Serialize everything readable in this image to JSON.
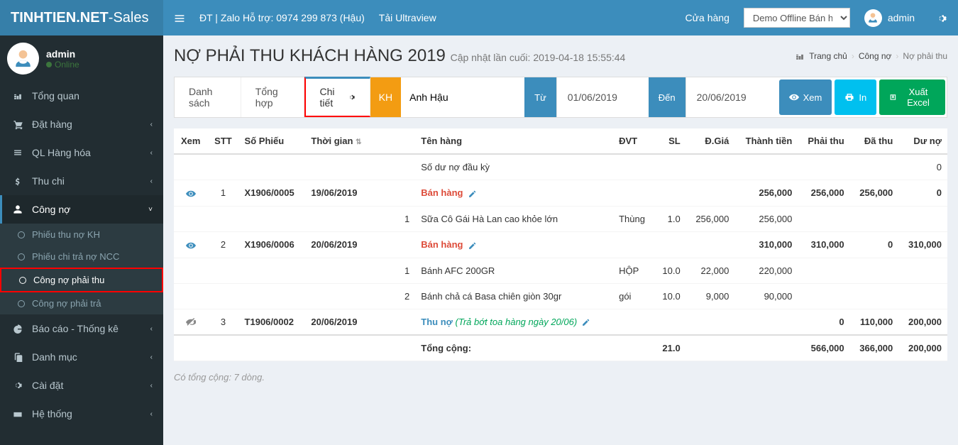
{
  "brand": {
    "b1": "TINHTIEN.NET",
    "b2": "-Sales"
  },
  "topbar": {
    "support": "ĐT | Zalo Hỗ trợ: 0974 299 873 (Hậu)",
    "ultraview": "Tải Ultraview",
    "store_label": "Cửa hàng",
    "store_value": "Demo Offline Bán hàn",
    "user": "admin"
  },
  "user_panel": {
    "name": "admin",
    "status": "Online"
  },
  "sidebar": {
    "items": [
      {
        "label": "Tổng quan",
        "icon": "dashboard",
        "expandable": false
      },
      {
        "label": "Đặt hàng",
        "icon": "cart",
        "expandable": true
      },
      {
        "label": "QL Hàng hóa",
        "icon": "list",
        "expandable": true
      },
      {
        "label": "Thu chi",
        "icon": "dollar",
        "expandable": true
      },
      {
        "label": "Công nợ",
        "icon": "user",
        "expandable": true,
        "open": true,
        "children": [
          {
            "label": "Phiếu thu nợ KH"
          },
          {
            "label": "Phiếu chi trả nợ NCC"
          },
          {
            "label": "Công nợ phải thu",
            "active": true
          },
          {
            "label": "Công nợ phải trả"
          }
        ]
      },
      {
        "label": "Báo cáo - Thống kê",
        "icon": "pie",
        "expandable": true
      },
      {
        "label": "Danh mục",
        "icon": "copy",
        "expandable": true
      },
      {
        "label": "Cài đặt",
        "icon": "gear",
        "expandable": true
      },
      {
        "label": "Hệ thống",
        "icon": "window",
        "expandable": true
      }
    ]
  },
  "page": {
    "title": "NỢ PHẢI THU KHÁCH HÀNG 2019",
    "subtitle": "Cập nhật lần cuối: 2019-04-18 15:55:44"
  },
  "breadcrumb": {
    "home": "Trang chủ",
    "b1": "Công nợ",
    "b2": "Nợ phải thu"
  },
  "tabs": {
    "list": "Danh sách",
    "summary": "Tổng hợp",
    "detail": "Chi tiết"
  },
  "filter": {
    "kh_label": "KH",
    "kh_value": "Anh Hậu",
    "from_label": "Từ",
    "from_value": "01/06/2019",
    "to_label": "Đến",
    "to_value": "20/06/2019",
    "btn_view": "Xem",
    "btn_print": "In",
    "btn_excel": "Xuất Excel"
  },
  "table": {
    "headers": {
      "view": "Xem",
      "stt": "STT",
      "phieu": "Số Phiếu",
      "time": "Thời gian",
      "name": "Tên hàng",
      "dvt": "ĐVT",
      "sl": "SL",
      "dgia": "Đ.Giá",
      "thanhtien": "Thành tiền",
      "phaithu": "Phải thu",
      "dathu": "Đã thu",
      "duno": "Dư nợ"
    },
    "opening_row": {
      "name": "Số dư nợ đầu kỳ",
      "duno": "0"
    },
    "rows": [
      {
        "type": "header",
        "eye": "on",
        "stt": "1",
        "phieu": "X1906/0005",
        "time": "19/06/2019",
        "name": "Bán hàng",
        "name_class": "red",
        "thanhtien": "256,000",
        "phaithu": "256,000",
        "dathu": "256,000",
        "duno": "0"
      },
      {
        "type": "item",
        "stt_item": "1",
        "name": "Sữa Cô Gái Hà Lan cao khỏe lớn",
        "dvt": "Thùng",
        "sl": "1.0",
        "dgia": "256,000",
        "thanhtien": "256,000"
      },
      {
        "type": "header",
        "eye": "on",
        "stt": "2",
        "phieu": "X1906/0006",
        "time": "20/06/2019",
        "name": "Bán hàng",
        "name_class": "red",
        "thanhtien": "310,000",
        "phaithu": "310,000",
        "dathu": "0",
        "duno": "310,000"
      },
      {
        "type": "item",
        "stt_item": "1",
        "name": "Bánh AFC 200GR",
        "dvt": "HỘP",
        "sl": "10.0",
        "dgia": "22,000",
        "thanhtien": "220,000"
      },
      {
        "type": "item",
        "stt_item": "2",
        "name": "Bánh chả cá Basa chiên giòn 30gr",
        "dvt": "gói",
        "sl": "10.0",
        "dgia": "9,000",
        "thanhtien": "90,000"
      },
      {
        "type": "header",
        "eye": "off",
        "stt": "3",
        "phieu": "T1906/0002",
        "time": "20/06/2019",
        "name": "Thu nợ",
        "name_class": "blue",
        "note": "(Trả bớt toa hàng ngày 20/06)",
        "thanhtien": "",
        "phaithu": "0",
        "dathu": "110,000",
        "duno": "200,000"
      }
    ],
    "totals": {
      "label": "Tổng cộng:",
      "sl": "21.0",
      "phaithu": "566,000",
      "dathu": "366,000",
      "duno": "200,000"
    },
    "footer_note": "Có tổng cộng: 7 dòng."
  }
}
